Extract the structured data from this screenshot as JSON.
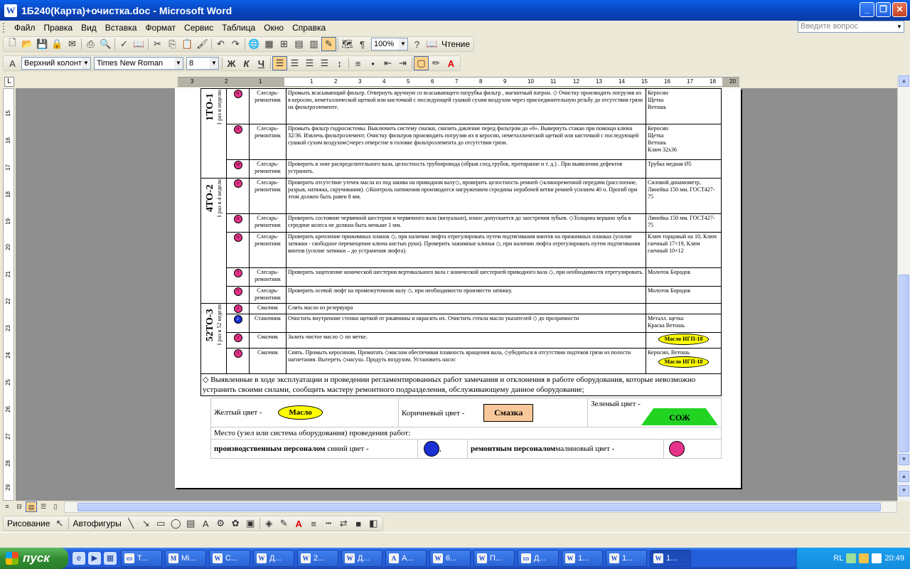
{
  "window": {
    "title": "1Б240(Карта)+очистка.doc - Microsoft Word",
    "app_letter": "W"
  },
  "menu": {
    "items": [
      "Файл",
      "Правка",
      "Вид",
      "Вставка",
      "Формат",
      "Сервис",
      "Таблица",
      "Окно",
      "Справка"
    ],
    "ask_placeholder": "Введите вопрос"
  },
  "toolbar_standard": {
    "zoom": "100%",
    "read_label": "Чтение"
  },
  "toolbar_format": {
    "style": "Верхний колонт",
    "font": "Times New Roman",
    "size": "8",
    "bold": "Ж",
    "italic": "К",
    "underline": "Ч"
  },
  "ruler": {
    "numbers": [
      "3",
      "2",
      "1",
      "1",
      "2",
      "3",
      "4",
      "5",
      "6",
      "7",
      "8",
      "9",
      "10",
      "11",
      "12",
      "13",
      "14",
      "15",
      "16",
      "17",
      "18",
      "19",
      "20"
    ],
    "vnumbers": [
      "15",
      "16",
      "17",
      "18",
      "19",
      "20",
      "21",
      "22",
      "23",
      "24",
      "25",
      "26",
      "27",
      "28",
      "29"
    ]
  },
  "document": {
    "groups": [
      {
        "title": "1ТО-1",
        "freq": "1 раз в неделю"
      },
      {
        "title": "4ТО-2",
        "freq": "1 раз в 4 недели"
      },
      {
        "title": "52ТО-3",
        "freq": "1 раз в 52 недели"
      }
    ],
    "rows": [
      {
        "num": "8",
        "color": "pink",
        "role": "Слесарь-ремонтник",
        "text": "Промыть всасывающий фильтр. Отвернуть вручную со всасывающего патрубка фильтр , магнитный патрон. ◇ Очистку производить погрузив их в керосин, неметаллической щеткой или кисточкой с последующей сушкой сухим воздухом через присоединительную резьбу до отсутствия грязи на фильтроэлементе.",
        "tools": "Керосин\nЩетка\nВетошь"
      },
      {
        "num": "9",
        "color": "pink",
        "role": "Слесарь-ремонтник",
        "text": "Промыть фильтр гидросистемы. Выключить систему смазки, снизить давление перед фильтром до «0». Вывернуть стакан при помощи ключа 32/36. Извлечь фильтроэлемент. Очистку фильтров производить погрузив их в керосин, неметаллической щеткой или кисточкой с последующей сушкой сухим воздухом◇через отверстие в головке фильтроэлемента до отсутствия грязи.",
        "tools": "Керосин\nЩетка\nВетошь\nКлюч 32х36"
      },
      {
        "num": "10",
        "color": "pink",
        "role": "Слесарь-ремонтник",
        "text": "Проверить в зоне распределительного вала, целостность трубопровода (обрыв соед.трубок, протирание и т. д.) . При выявлении дефектов устранить.",
        "tools": "Трубка медная Ø5"
      },
      {
        "num": "3",
        "color": "pink",
        "role": "Слесарь-ремонтник",
        "text": "Проверить отсутствие утечек масла из под шкива на приводном валу◇, проверить целостность ремней ◇клиноременной передачи (расслоение, разрыв, натяжка, скручивания). ◇Контроль натяжения производится нагружением середины нерабочей ветви ремней усилием 40 н. Прогиб при этом должен быть равен 8 мм.",
        "tools": "Силовой динамометр, Линейка 150 мм. ГОСТ427-75"
      },
      {
        "num": "9",
        "color": "pink",
        "role": "Слесарь-ремонтник",
        "text": "Проверить состояние червячной шестерни и червячного вала (визуально), износ допускается до заострения зубьев. ◇Толщина вершин зуба в середине колеса не должна быть меньше 1 мм.",
        "tools": "Линейка 150 мм. ГОСТ427-75"
      },
      {
        "num": "11",
        "color": "pink",
        "role": "Слесарь-ремонтник",
        "text": "Проверить крепление прижимных планок ◇, при наличии люфта отрегулировать путем подтягивания винтов на прижимных планках (усилие затяжки - свободное перемещение ключа кистью руки). Проверить зажимные клинья ◇, при наличии люфта отрегулировать путем подтягивания винтов (усилие затяжки – до устранения люфта).",
        "tools": "Ключ торцовый на 10, Ключ гаечный 17×19, Ключ гаечный 10×12"
      },
      {
        "num": "7",
        "color": "pink",
        "role": "Слесарь-ремонтник",
        "text": "Проверить зацепление конической шестерни вертикального вала с конической шестерней приводного вала ◇, при необходимости отрегулировать.",
        "tools": "Молоток Бородок"
      },
      {
        "num": "7",
        "color": "pink",
        "role": "Слесарь-ремонтник",
        "text": "Проверить осевой люфт на промежуточном валу ◇, при необходимости произвести затяжку.",
        "tools": "Молоток Бородок"
      },
      {
        "num": "2",
        "color": "pink",
        "role": "Смазчик",
        "text": "Слить масло из резервуара",
        "tools": ""
      },
      {
        "num": "2",
        "color": "blue",
        "role": "Станочник",
        "text": "Очистить внутренние стенки щеткой от ржавчины и окрасить их. Очистить стекла масло указателей ◇ до прозрачности",
        "tools": "Металл. щетка\nКраска Ветошь"
      },
      {
        "num": "2",
        "color": "pink",
        "role": "Смазчик",
        "text": "Залить чистое масло ◇ по метке.",
        "tools": "",
        "oval": "Масло ИГП-18"
      },
      {
        "num": "3",
        "color": "pink",
        "role": "Смазчик",
        "text": "Снять. Промыть керосином, Проматать ◇маслом обеспечивая плавность вращения вала, ◇убедиться в отсутствии подтеков грязи из полости нагнетания. Вытереть ◇насухо. Продуть воздухом. Установить насос",
        "tools": "Керосин, Ветошь",
        "oval": "Масло ИГП-18"
      }
    ],
    "note": "◇ Выявленные в ходе эксплуатации и проведении регламентированных работ замечания и отклонения в работе оборудования, которые невозможно устранить своими силами, сообщить мастеру ремонтного подразделения, обслуживающему данное оборудование;",
    "legend": {
      "yellow_label": "Желтый цвет -",
      "yellow_value": "Масло",
      "brown_label": "Коричневый цвет -",
      "brown_value": "Смазка",
      "green_label": "Зеленый цвет -",
      "green_value": "СОЖ",
      "place_label": "Место (узел или система оборудования) проведения работ:",
      "prod_bold": "производственным персоналом",
      "prod_rest": " синий цвет -",
      "repair_bold": "ремонтным персоналом",
      "repair_rest": " малиновый цвет -",
      "comma": ","
    },
    "colors": {
      "pink": "#e8338a",
      "blue": "#1a2fd6",
      "yellow": "#ffff00",
      "brown": "#f9c89a",
      "green": "#22d322"
    }
  },
  "drawbar": {
    "draw_label": "Рисование",
    "autoshapes_label": "Автофигуры"
  },
  "taskbar": {
    "start_label": "пуск",
    "tasks": [
      "Т...",
      "Mi...",
      "С...",
      "Д...",
      "2...",
      "Д...",
      "А...",
      "6...",
      "П...",
      "Д...",
      "1...",
      "1...",
      "1..."
    ],
    "lang": "RL",
    "clock": "20:49"
  }
}
